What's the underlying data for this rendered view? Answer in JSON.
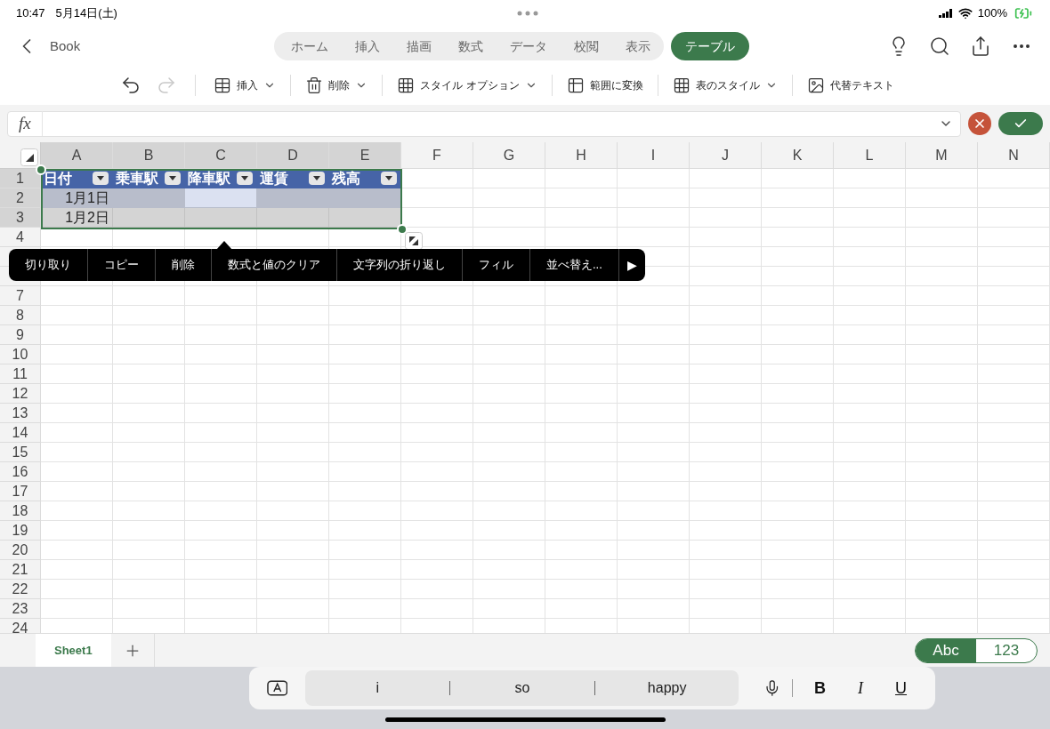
{
  "status_bar": {
    "time": "10:47",
    "date": "5月14日(土)",
    "battery": "100%"
  },
  "nav": {
    "back_label": "Book",
    "tabs": [
      {
        "label": "ホーム",
        "selected": false
      },
      {
        "label": "挿入",
        "selected": false
      },
      {
        "label": "描画",
        "selected": false
      },
      {
        "label": "数式",
        "selected": false
      },
      {
        "label": "データ",
        "selected": false
      },
      {
        "label": "校閲",
        "selected": false
      },
      {
        "label": "表示",
        "selected": false
      },
      {
        "label": "テーブル",
        "selected": true
      }
    ]
  },
  "toolbar": [
    {
      "kind": "undo",
      "disabled": false
    },
    {
      "kind": "redo",
      "disabled": true
    },
    {
      "kind": "insert",
      "label": "挿入",
      "dropdown": true
    },
    {
      "kind": "delete",
      "label": "削除",
      "dropdown": true
    },
    {
      "kind": "style_options",
      "label": "スタイル オプション",
      "dropdown": true
    },
    {
      "kind": "convert",
      "label": "範囲に変換",
      "dropdown": false
    },
    {
      "kind": "table_style",
      "label": "表のスタイル",
      "dropdown": true
    },
    {
      "kind": "alt_text",
      "label": "代替テキスト",
      "dropdown": false
    }
  ],
  "formula_bar": {
    "label": "fx"
  },
  "sheet": {
    "columns": [
      {
        "label": "A",
        "selected": true
      },
      {
        "label": "B",
        "selected": true
      },
      {
        "label": "C",
        "selected": true
      },
      {
        "label": "D",
        "selected": true
      },
      {
        "label": "E",
        "selected": true
      },
      {
        "label": "F",
        "selected": false
      },
      {
        "label": "G",
        "selected": false
      },
      {
        "label": "H",
        "selected": false
      },
      {
        "label": "I",
        "selected": false
      },
      {
        "label": "J",
        "selected": false
      },
      {
        "label": "K",
        "selected": false
      },
      {
        "label": "L",
        "selected": false
      },
      {
        "label": "M",
        "selected": false
      },
      {
        "label": "N",
        "selected": false
      }
    ],
    "row_labels": [
      {
        "label": "1",
        "selected": true
      },
      {
        "label": "2",
        "selected": true
      },
      {
        "label": "3",
        "selected": true
      },
      {
        "label": "4",
        "selected": false
      },
      {
        "selected": false
      },
      {
        "selected": false
      },
      {
        "label": "7",
        "selected": false
      },
      {
        "label": "8",
        "selected": false
      },
      {
        "label": "9",
        "selected": false
      },
      {
        "label": "10",
        "selected": false
      },
      {
        "label": "11",
        "selected": false
      },
      {
        "label": "12",
        "selected": false
      },
      {
        "label": "13",
        "selected": false
      },
      {
        "label": "14",
        "selected": false
      },
      {
        "label": "15",
        "selected": false
      },
      {
        "label": "16",
        "selected": false
      },
      {
        "label": "17",
        "selected": false
      },
      {
        "label": "18",
        "selected": false
      },
      {
        "label": "19",
        "selected": false
      },
      {
        "label": "20",
        "selected": false
      },
      {
        "label": "21",
        "selected": false
      },
      {
        "label": "22",
        "selected": false
      },
      {
        "label": "23",
        "selected": false
      },
      {
        "label": "24",
        "selected": false
      }
    ],
    "table_headers": [
      "日付",
      "乗車駅",
      "降車駅",
      "運賃",
      "残高"
    ],
    "table_rows": [
      {
        "cells": [
          {
            "text": "1月1日",
            "selected": false
          },
          {
            "text": "",
            "selected": false
          },
          {
            "text": "",
            "selected": true
          },
          {
            "text": "",
            "selected": false
          },
          {
            "text": "",
            "selected": false
          }
        ]
      },
      {
        "cells": [
          {
            "text": "1月2日",
            "selected": false
          },
          {
            "text": "",
            "selected": false
          },
          {
            "text": "",
            "selected": false
          },
          {
            "text": "",
            "selected": false
          },
          {
            "text": "",
            "selected": false
          }
        ]
      }
    ]
  },
  "context_menu": {
    "items": [
      "切り取り",
      "コピー",
      "削除",
      "数式と値のクリア",
      "文字列の折り返し",
      "フィル",
      "並べ替え..."
    ],
    "more": "▶"
  },
  "sheet_tabs": [
    {
      "label": "Sheet1",
      "selected": true
    }
  ],
  "input_mode": [
    {
      "label": "Abc",
      "selected": true
    },
    {
      "label": "123",
      "selected": false
    }
  ],
  "keyboard_bar": {
    "suggestions": [
      "i",
      "so",
      "happy"
    ],
    "format_buttons": [
      "B",
      "I",
      "U"
    ]
  }
}
